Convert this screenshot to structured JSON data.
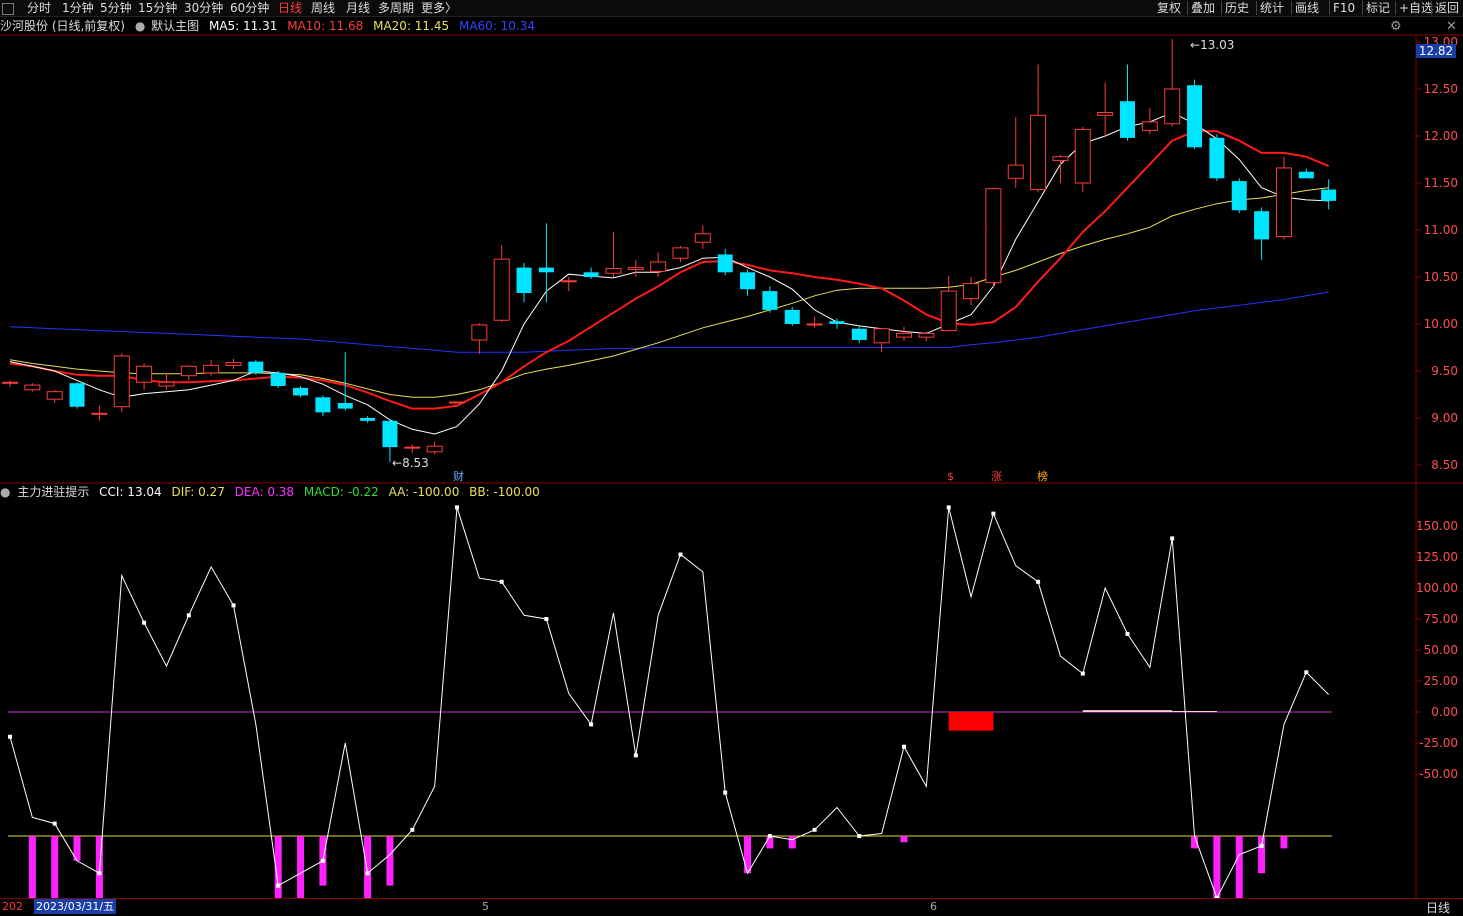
{
  "toolbar": {
    "periods": [
      "分时",
      "1分钟",
      "5分钟",
      "15分钟",
      "30分钟",
      "60分钟",
      "日线",
      "周线",
      "月线",
      "多周期",
      "更多〉"
    ],
    "active": "日线",
    "right_buttons": [
      "复权",
      "叠加",
      "历史",
      "统计",
      "画线",
      "F10",
      "标记",
      "+自选",
      "返回"
    ]
  },
  "header": {
    "stock": "沙河股份 (日线,前复权)",
    "template": "默认主图",
    "ma5": "MA5: 11.31",
    "ma10": "MA10: 11.68",
    "ma20": "MA20: 11.45",
    "ma60": "MA60: 10.34"
  },
  "indicator": {
    "name": "主力进驻提示",
    "cci": "CCI: 13.04",
    "dif": "DIF: 0.27",
    "dea": "DEA: 0.38",
    "macd": "MACD: -0.22",
    "aa": "AA: -100.00",
    "bb": "BB: -100.00"
  },
  "price_axis": {
    "labels": [
      "13.00",
      "12.50",
      "12.00",
      "11.50",
      "11.00",
      "10.50",
      "10.00",
      "9.50",
      "9.00",
      "8.50"
    ],
    "current_price": "12.82"
  },
  "ind_axis": {
    "labels": [
      "150.00",
      "125.00",
      "100.00",
      "75.00",
      "50.00",
      "25.00",
      "0.00",
      "-25.00",
      "-50.00"
    ]
  },
  "annotations": {
    "high": "13.03",
    "low": "8.53"
  },
  "event_marks": [
    {
      "label": "财",
      "color": "#6fa8ff"
    },
    {
      "label": "$",
      "color": "#ff3b3b"
    },
    {
      "label": "涨",
      "color": "#ff3b3b"
    },
    {
      "label": "榜",
      "color": "#ffaa00"
    }
  ],
  "date_axis": {
    "left_label": "202",
    "cursor_date": "2023/03/31/五",
    "month_labels": [
      "5",
      "6"
    ],
    "period_label": "日线"
  },
  "colors": {
    "up": "#ff3b3b",
    "down": "#00e5ff",
    "ma5": "#ffffff",
    "ma10": "#ff1a1a",
    "ma20": "#e8e05a",
    "ma60": "#2233ff",
    "cci": "#ffffff",
    "zero_line": "#cc33cc",
    "bars": "#ff22ff",
    "hundred_line": "#dddd33",
    "macd_red": "#ff0000"
  },
  "chart_data": {
    "type": "candlestick",
    "candles": [
      [
        9.38,
        9.38,
        9.33,
        9.4
      ],
      [
        9.3,
        9.35,
        9.28,
        9.37
      ],
      [
        9.2,
        9.28,
        9.16,
        9.3
      ],
      [
        9.37,
        9.12,
        9.1,
        9.38
      ],
      [
        9.05,
        9.05,
        8.97,
        9.13
      ],
      [
        9.12,
        9.66,
        9.06,
        9.69
      ],
      [
        9.38,
        9.55,
        9.3,
        9.58
      ],
      [
        9.34,
        9.38,
        9.3,
        9.48
      ],
      [
        9.45,
        9.55,
        9.4,
        9.56
      ],
      [
        9.48,
        9.56,
        9.45,
        9.62
      ],
      [
        9.56,
        9.59,
        9.52,
        9.63
      ],
      [
        9.6,
        9.48,
        9.46,
        9.62
      ],
      [
        9.48,
        9.34,
        9.32,
        9.5
      ],
      [
        9.32,
        9.24,
        9.22,
        9.34
      ],
      [
        9.22,
        9.06,
        9.02,
        9.24
      ],
      [
        9.16,
        9.1,
        9.08,
        9.7
      ],
      [
        9.0,
        8.97,
        8.95,
        9.02
      ],
      [
        8.97,
        8.69,
        8.53,
        8.98
      ],
      [
        8.68,
        8.69,
        8.63,
        8.72
      ],
      [
        8.64,
        8.7,
        8.61,
        8.75
      ],
      [
        9.16,
        9.17,
        9.16,
        9.17
      ],
      [
        9.83,
        9.99,
        9.68,
        10.01
      ],
      [
        10.04,
        10.69,
        10.02,
        10.84
      ],
      [
        10.6,
        10.33,
        10.23,
        10.65
      ],
      [
        10.6,
        10.55,
        10.23,
        11.07
      ],
      [
        10.45,
        10.46,
        10.35,
        10.5
      ],
      [
        10.55,
        10.5,
        10.48,
        10.6
      ],
      [
        10.54,
        10.59,
        10.5,
        10.98
      ],
      [
        10.58,
        10.6,
        10.5,
        10.68
      ],
      [
        10.56,
        10.66,
        10.5,
        10.76
      ],
      [
        10.7,
        10.81,
        10.66,
        10.83
      ],
      [
        10.87,
        10.96,
        10.8,
        11.05
      ],
      [
        10.74,
        10.55,
        10.52,
        10.8
      ],
      [
        10.55,
        10.37,
        10.3,
        10.58
      ],
      [
        10.35,
        10.15,
        10.12,
        10.4
      ],
      [
        10.15,
        10.0,
        9.98,
        10.18
      ],
      [
        10.0,
        10.0,
        9.96,
        10.08
      ],
      [
        10.03,
        10.0,
        9.95,
        10.06
      ],
      [
        9.95,
        9.83,
        9.8,
        9.98
      ],
      [
        9.8,
        9.95,
        9.7,
        9.96
      ],
      [
        9.86,
        9.9,
        9.82,
        9.97
      ],
      [
        9.86,
        9.9,
        9.82,
        9.92
      ],
      [
        9.93,
        10.35,
        9.92,
        10.51
      ],
      [
        10.27,
        10.43,
        10.2,
        10.5
      ],
      [
        10.44,
        11.44,
        10.4,
        11.45
      ],
      [
        11.55,
        11.69,
        11.45,
        12.2
      ],
      [
        11.43,
        12.22,
        11.4,
        12.76
      ],
      [
        11.74,
        11.78,
        11.5,
        11.8
      ],
      [
        11.5,
        12.07,
        11.4,
        12.1
      ],
      [
        12.22,
        12.25,
        12.0,
        12.57
      ],
      [
        12.37,
        11.98,
        11.95,
        12.76
      ],
      [
        12.06,
        12.15,
        12.02,
        12.3
      ],
      [
        12.13,
        12.5,
        12.1,
        13.03
      ],
      [
        12.54,
        11.88,
        11.86,
        12.6
      ],
      [
        11.98,
        11.55,
        11.52,
        12.02
      ],
      [
        11.52,
        11.21,
        11.18,
        11.55
      ],
      [
        11.2,
        10.9,
        10.68,
        11.24
      ],
      [
        10.93,
        11.66,
        10.9,
        11.78
      ],
      [
        11.62,
        11.55,
        11.55,
        11.65
      ],
      [
        11.43,
        11.31,
        11.22,
        11.54
      ]
    ],
    "ma5": [
      9.6,
      9.55,
      9.5,
      9.4,
      9.3,
      9.22,
      9.26,
      9.28,
      9.3,
      9.35,
      9.4,
      9.5,
      9.48,
      9.44,
      9.36,
      9.24,
      9.14,
      8.98,
      8.88,
      8.83,
      8.91,
      9.15,
      9.5,
      10.0,
      10.35,
      10.53,
      10.51,
      10.49,
      10.55,
      10.55,
      10.6,
      10.7,
      10.71,
      10.6,
      10.5,
      10.37,
      10.15,
      10.02,
      9.98,
      9.95,
      9.92,
      9.9,
      10.0,
      10.1,
      10.4,
      10.9,
      11.3,
      11.7,
      11.92,
      12.0,
      12.1,
      12.15,
      12.25,
      12.13,
      11.97,
      11.75,
      11.45,
      11.35,
      11.32,
      11.31
    ],
    "ma10": [
      9.58,
      9.55,
      9.5,
      9.46,
      9.45,
      9.45,
      9.4,
      9.38,
      9.38,
      9.39,
      9.4,
      9.42,
      9.44,
      9.43,
      9.4,
      9.35,
      9.27,
      9.18,
      9.1,
      9.1,
      9.13,
      9.25,
      9.38,
      9.55,
      9.7,
      9.82,
      9.97,
      10.12,
      10.27,
      10.4,
      10.55,
      10.66,
      10.67,
      10.63,
      10.57,
      10.54,
      10.5,
      10.47,
      10.43,
      10.38,
      10.25,
      10.1,
      10.01,
      9.99,
      10.02,
      10.18,
      10.45,
      10.7,
      10.98,
      11.2,
      11.45,
      11.7,
      11.95,
      12.05,
      12.05,
      11.95,
      11.82,
      11.82,
      11.78,
      11.68
    ],
    "ma20": [
      9.62,
      9.58,
      9.55,
      9.52,
      9.5,
      9.48,
      9.47,
      9.47,
      9.47,
      9.48,
      9.48,
      9.48,
      9.47,
      9.46,
      9.42,
      9.37,
      9.31,
      9.25,
      9.22,
      9.22,
      9.25,
      9.3,
      9.38,
      9.47,
      9.52,
      9.56,
      9.61,
      9.66,
      9.73,
      9.8,
      9.88,
      9.96,
      10.02,
      10.08,
      10.15,
      10.22,
      10.3,
      10.36,
      10.38,
      10.38,
      10.38,
      10.38,
      10.39,
      10.42,
      10.5,
      10.57,
      10.66,
      10.75,
      10.83,
      10.9,
      10.96,
      11.03,
      11.15,
      11.22,
      11.28,
      11.32,
      11.34,
      11.38,
      11.42,
      11.45
    ],
    "ma60": [
      9.97,
      9.96,
      9.95,
      9.94,
      9.93,
      9.92,
      9.91,
      9.9,
      9.89,
      9.88,
      9.87,
      9.86,
      9.85,
      9.84,
      9.82,
      9.8,
      9.78,
      9.76,
      9.74,
      9.72,
      9.7,
      9.7,
      9.7,
      9.7,
      9.71,
      9.72,
      9.73,
      9.74,
      9.74,
      9.75,
      9.75,
      9.75,
      9.75,
      9.75,
      9.75,
      9.75,
      9.75,
      9.75,
      9.75,
      9.75,
      9.75,
      9.75,
      9.75,
      9.78,
      9.8,
      9.83,
      9.86,
      9.9,
      9.94,
      9.98,
      10.02,
      10.06,
      10.1,
      10.14,
      10.17,
      10.2,
      10.23,
      10.26,
      10.3,
      10.34
    ],
    "cci": [
      -20,
      -85,
      -90,
      -120,
      -130,
      110,
      72,
      37,
      78,
      117,
      86,
      -10,
      -140,
      -130,
      -120,
      -25,
      -130,
      -115,
      -95,
      -60,
      165,
      108,
      105,
      78,
      75,
      15,
      -10,
      80,
      -35,
      78,
      127,
      113,
      -65,
      -130,
      -100,
      -103,
      -95,
      -77,
      -100,
      -98,
      -28,
      -60,
      165,
      93,
      160,
      118,
      105,
      45,
      31,
      100,
      63,
      36,
      140,
      -100,
      -150,
      -115,
      -108,
      -10,
      32,
      14
    ],
    "bars": [
      -100,
      -150,
      -150,
      -120,
      -150,
      0,
      0,
      0,
      0,
      0,
      0,
      0,
      -150,
      -150,
      -140,
      0,
      -150,
      -140,
      -100,
      0,
      0,
      0,
      0,
      0,
      0,
      0,
      0,
      0,
      0,
      0,
      0,
      0,
      0,
      -130,
      -110,
      -110,
      0,
      0,
      0,
      0,
      -105,
      0,
      0,
      0,
      0,
      0,
      0,
      0,
      0,
      0,
      0,
      0,
      0,
      -110,
      -150,
      -150,
      -130,
      -110,
      0,
      0
    ],
    "macd_hist": [
      {
        "from": 42,
        "to": 44,
        "value": -15
      },
      {
        "from": 48,
        "to": 52,
        "value": 1.5
      },
      {
        "from": 52,
        "to": 54,
        "value": 0.8
      }
    ],
    "ylim_price": [
      8.4,
      13.1
    ],
    "ylim_ind": [
      -170,
      170
    ]
  }
}
